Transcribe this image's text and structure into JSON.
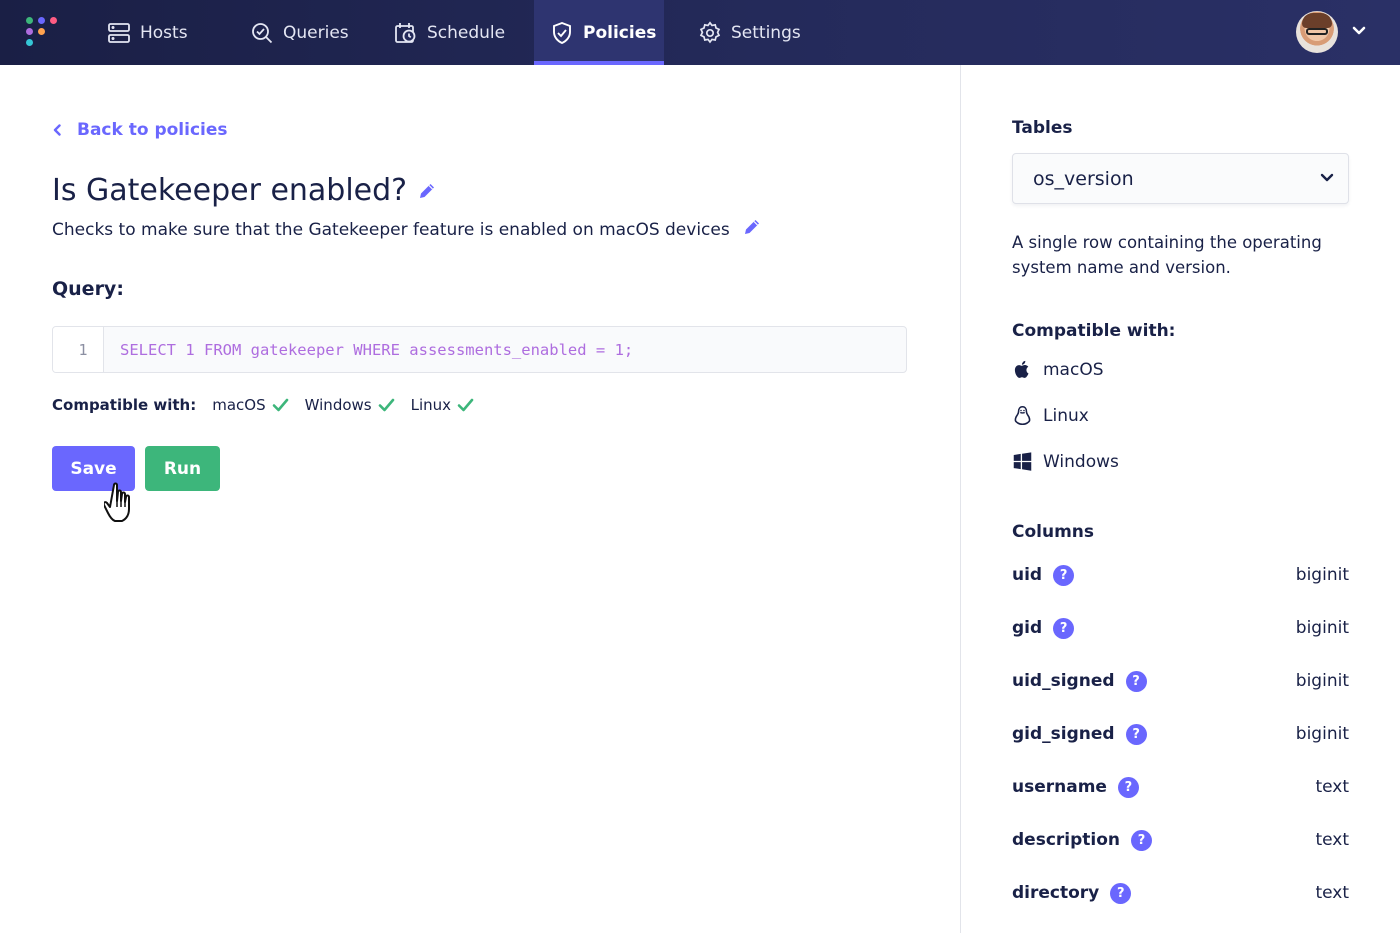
{
  "nav": {
    "items": [
      {
        "label": "Hosts",
        "icon": "hosts-icon"
      },
      {
        "label": "Queries",
        "icon": "queries-icon"
      },
      {
        "label": "Schedule",
        "icon": "schedule-icon"
      },
      {
        "label": "Policies",
        "icon": "policies-icon",
        "active": true
      },
      {
        "label": "Settings",
        "icon": "settings-icon"
      }
    ]
  },
  "policy": {
    "back_label": "Back to policies",
    "title": "Is Gatekeeper enabled?",
    "description": "Checks to make sure that the Gatekeeper feature is enabled on macOS devices",
    "query_label": "Query:",
    "line_number": "1",
    "query": "SELECT 1 FROM gatekeeper WHERE assessments_enabled = 1;",
    "compat_label": "Compatible with:",
    "compat": [
      "macOS",
      "Windows",
      "Linux"
    ],
    "save_label": "Save",
    "run_label": "Run"
  },
  "sidebar": {
    "tables_heading": "Tables",
    "selected_table": "os_version",
    "table_description": "A single row containing the operating system name and version.",
    "compat_heading": "Compatible with:",
    "platforms": [
      "macOS",
      "Linux",
      "Windows"
    ],
    "columns_heading": "Columns",
    "help_glyph": "?",
    "columns": [
      {
        "name": "uid",
        "type": "biginit"
      },
      {
        "name": "gid",
        "type": "biginit"
      },
      {
        "name": "uid_signed",
        "type": "biginit"
      },
      {
        "name": "gid_signed",
        "type": "biginit"
      },
      {
        "name": "username",
        "type": "text"
      },
      {
        "name": "description",
        "type": "text"
      },
      {
        "name": "directory",
        "type": "text"
      }
    ]
  },
  "colors": {
    "nav_bg": "#1f2450",
    "accent": "#6a67fe",
    "success": "#3db67b",
    "code": "#ae6ddf",
    "text": "#192147"
  }
}
